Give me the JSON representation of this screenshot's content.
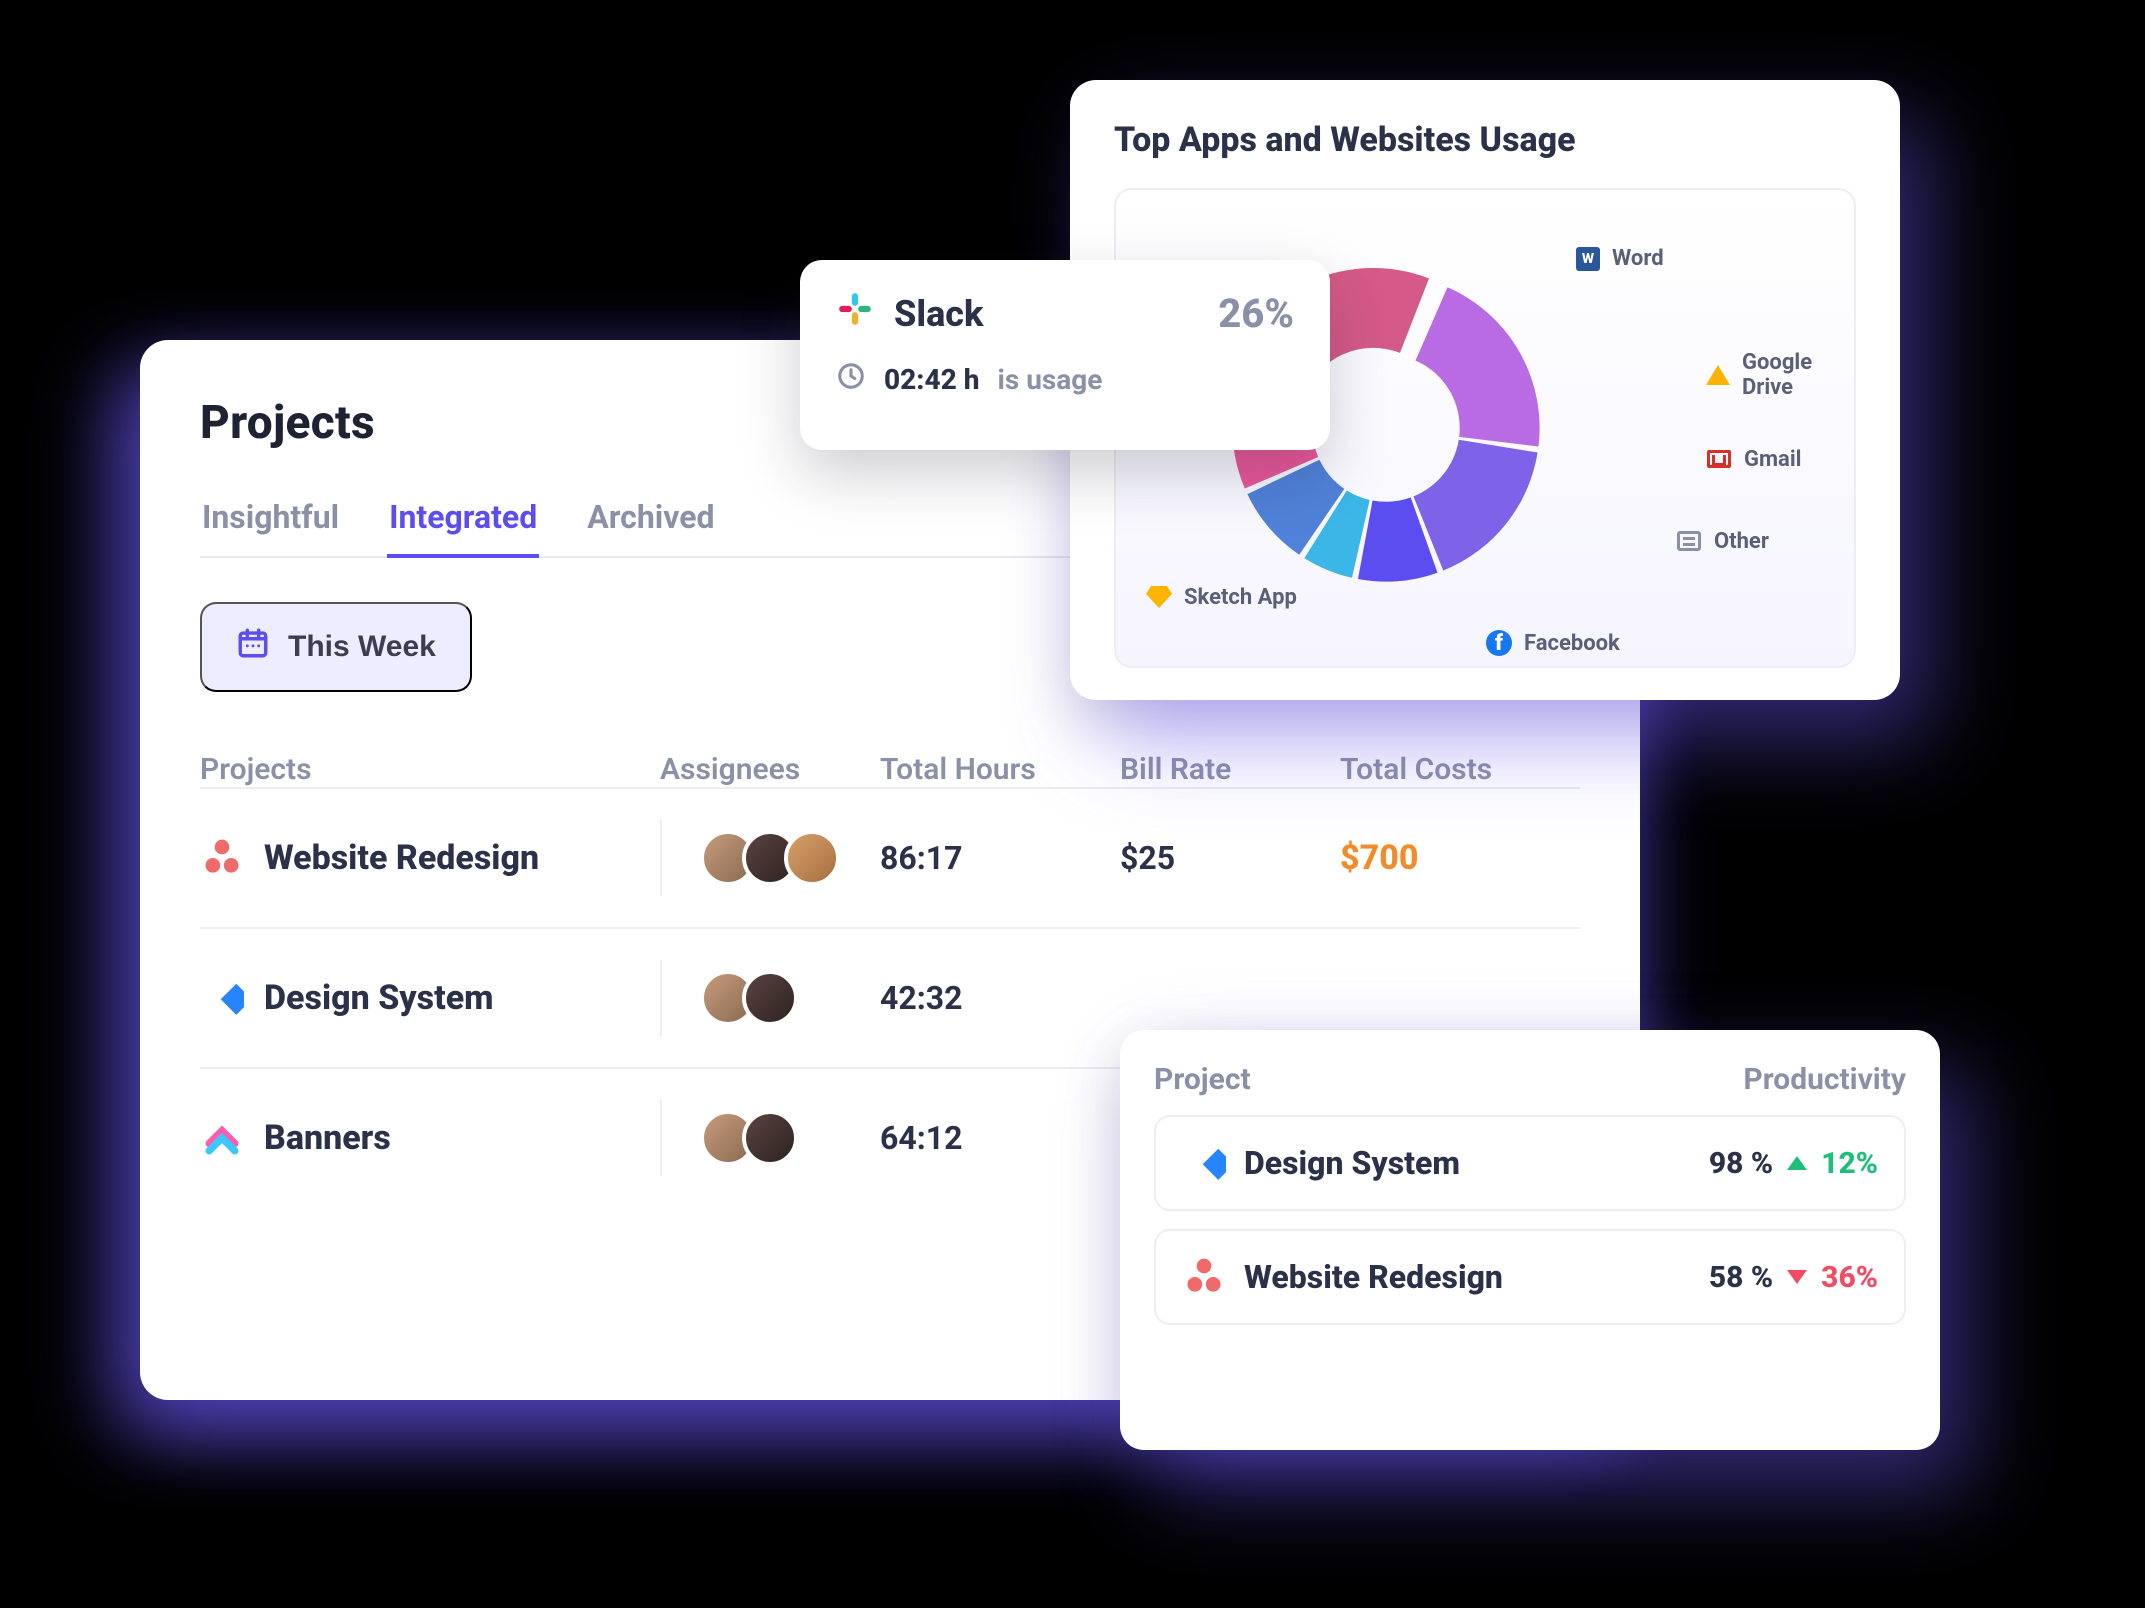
{
  "projects_card": {
    "title": "Projects",
    "tabs": [
      {
        "label": "Insightful",
        "active": false
      },
      {
        "label": "Integrated",
        "active": true
      },
      {
        "label": "Archived",
        "active": false
      }
    ],
    "filter_label": "This Week",
    "columns": [
      "Projects",
      "Assignees",
      "Total Hours",
      "Bill Rate",
      "Total Costs"
    ],
    "rows": [
      {
        "icon": "asana",
        "name": "Website Redesign",
        "assignees": 3,
        "total_hours": "86:17",
        "bill_rate": "$25",
        "total_costs": "$700"
      },
      {
        "icon": "jira",
        "name": "Design System",
        "assignees": 2,
        "total_hours": "42:32",
        "bill_rate": "",
        "total_costs": ""
      },
      {
        "icon": "clickup",
        "name": "Banners",
        "assignees": 2,
        "total_hours": "64:12",
        "bill_rate": "",
        "total_costs": ""
      }
    ]
  },
  "apps_card": {
    "title": "Top Apps and  Websites Usage",
    "legend": [
      {
        "key": "word",
        "label": "Word"
      },
      {
        "key": "google_drive",
        "label": "Google Drive"
      },
      {
        "key": "gmail",
        "label": "Gmail"
      },
      {
        "key": "other",
        "label": "Other"
      },
      {
        "key": "facebook",
        "label": "Facebook"
      },
      {
        "key": "sketch",
        "label": "Sketch App"
      }
    ],
    "tooltip": {
      "app": "Slack",
      "percent": "26%",
      "time": "02:42 h",
      "suffix": "is usage"
    }
  },
  "chart_data": {
    "type": "pie",
    "title": "Top Apps and  Websites Usage",
    "series": [
      {
        "name": "Slack",
        "value": 26,
        "color": "#d45a87"
      },
      {
        "name": "Word",
        "value": 21,
        "color": "#b86be3"
      },
      {
        "name": "Google Drive",
        "value": 17,
        "color": "#7e62e8"
      },
      {
        "name": "Gmail",
        "value": 9,
        "color": "#5b4df0"
      },
      {
        "name": "Other",
        "value": 6,
        "color": "#3bb6e6"
      },
      {
        "name": "Facebook",
        "value": 9,
        "color": "#4f82d8"
      },
      {
        "name": "Sketch App",
        "value": 12,
        "color": "#e9579a"
      }
    ],
    "donut_inner_ratio": 0.48
  },
  "productivity_card": {
    "columns": [
      "Project",
      "Productivity"
    ],
    "rows": [
      {
        "icon": "jira",
        "name": "Design System",
        "value": "98 %",
        "delta": "12%",
        "direction": "up"
      },
      {
        "icon": "asana",
        "name": "Website Redesign",
        "value": "58 %",
        "delta": "36%",
        "direction": "down"
      }
    ]
  }
}
